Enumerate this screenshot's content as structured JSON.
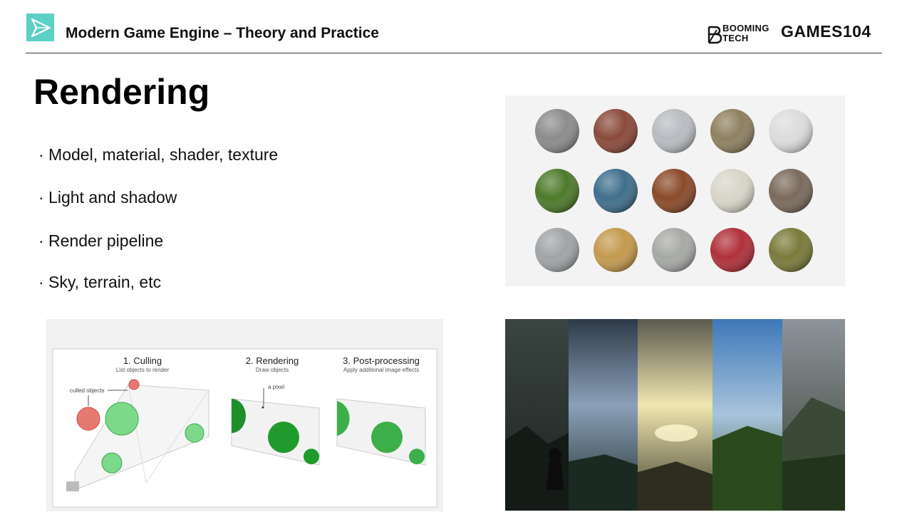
{
  "header": {
    "course_title": "Modern Game Engine – Theory and Practice",
    "brand_booming_line1": "BOOMING",
    "brand_booming_line2": "TECH",
    "brand_games": "GAMES104"
  },
  "slide": {
    "title": "Rendering",
    "bullets": [
      "· Model, material, shader, texture",
      "· Light and shadow",
      "· Render pipeline",
      "· Sky, terrain, etc"
    ]
  },
  "pipeline_figure": {
    "stage1_title": "1. Culling",
    "stage1_sub": "List objects to render",
    "stage2_title": "2. Rendering",
    "stage2_sub": "Draw objects",
    "stage3_title": "3. Post-processing",
    "stage3_sub": "Apply additional image effects",
    "culled_label": "culled objects",
    "pixel_label": "a pixel"
  },
  "colors": {
    "accent_teal": "#5ccfc6",
    "rule": "#333333",
    "green_sphere": "#2fa33a",
    "red_sphere": "#d9534f"
  }
}
